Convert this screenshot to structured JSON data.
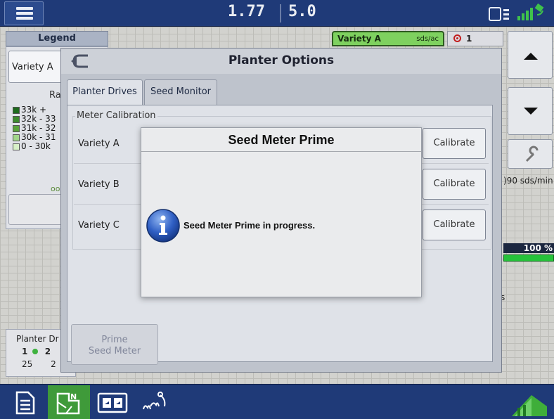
{
  "top_bar": {
    "value_1": "1.77",
    "value_2": "5.0",
    "icons": [
      "menu-icon",
      "connection-status-icon",
      "gps-signal-icon"
    ]
  },
  "legend": {
    "header": "Legend",
    "variety_button": "Variety A",
    "rate_label": "Ra",
    "items": [
      {
        "label": "33k +",
        "color": "#1e6b1e"
      },
      {
        "label": "32k - 33",
        "color": "#3d8b2e"
      },
      {
        "label": "31k - 32",
        "color": "#5aa33b"
      },
      {
        "label": "30k - 31",
        "color": "#a2d68a"
      },
      {
        "label": "0 - 30k",
        "color": "#d8f0c8"
      }
    ],
    "small_text": "oo"
  },
  "variety_tab": {
    "label": "Variety A",
    "unit": "sds/ac"
  },
  "alert_tab": {
    "count": "1"
  },
  "right_panel": {
    "rate_text": ")90 sds/min",
    "percent": "100 %",
    "s_text": "s"
  },
  "planter_drives_panel": {
    "title": "Planter Dr",
    "row_1": [
      "1",
      "2"
    ],
    "row_2": [
      "25",
      "2"
    ]
  },
  "planter_options": {
    "title": "Planter Options",
    "tabs": [
      "Planter Drives",
      "Seed Monitor"
    ],
    "section_label": "Meter Calibration",
    "rows": [
      {
        "label": "Variety A",
        "button": "Calibrate"
      },
      {
        "label": "Variety B",
        "button": "Calibrate"
      },
      {
        "label": "Variety C",
        "button": "Calibrate"
      }
    ],
    "prime_button": {
      "line_1": "Prime",
      "line_2": "Seed Meter"
    }
  },
  "seed_meter_prime": {
    "title": "Seed Meter Prime",
    "message": "Seed Meter Prime in progress."
  },
  "bottom_bar": {
    "items": [
      "document-icon",
      "field-map-icon",
      "split-view-icon",
      "seed-icon",
      "home-icon"
    ],
    "active": "field-map-icon"
  },
  "colors": {
    "top_bar": "#1f3a78",
    "variety_tab": "#7ed15f",
    "active_bottom_button": "#3f9a3a"
  }
}
